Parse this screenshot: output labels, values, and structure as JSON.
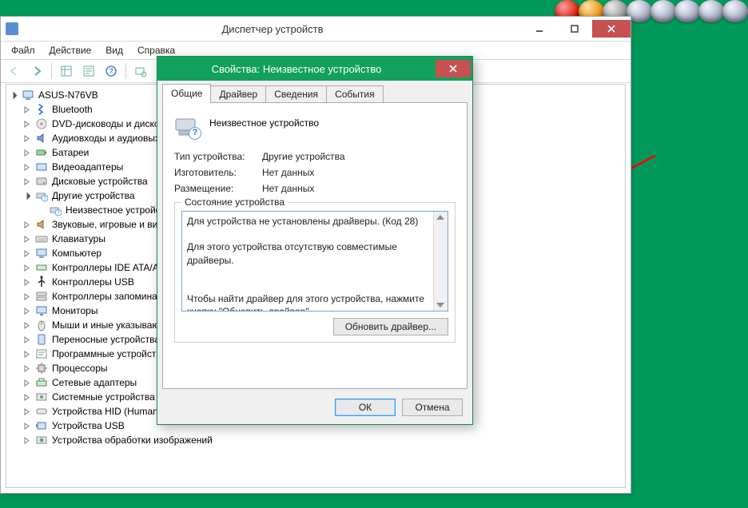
{
  "desktop": {
    "accent": "#00995B"
  },
  "tray_icons": [
    "red",
    "ora",
    "gry",
    "svr",
    "svr",
    "svr",
    "svr",
    "svr"
  ],
  "devmgr": {
    "title": "Диспетчер устройств",
    "menu": {
      "file": "Файл",
      "action": "Действие",
      "view": "Вид",
      "help": "Справка"
    },
    "toolbar": [
      "back",
      "fwd",
      "sep",
      "show",
      "props",
      "help",
      "sep",
      "scan",
      "uninst",
      "upd",
      "dis"
    ],
    "root": "ASUS-N76VB",
    "nodes": [
      {
        "icon": "bt",
        "label": "Bluetooth"
      },
      {
        "icon": "dvd",
        "label": "DVD-дисководы и дисководы компакт-дисков"
      },
      {
        "icon": "aud",
        "label": "Аудиовходы и аудиовыходы"
      },
      {
        "icon": "bat",
        "label": "Батареи"
      },
      {
        "icon": "vid",
        "label": "Видеоадаптеры"
      },
      {
        "icon": "dsk",
        "label": "Дисковые устройства"
      },
      {
        "icon": "unk",
        "label": "Другие устройства",
        "expanded": true,
        "children": [
          {
            "icon": "unk",
            "label": "Неизвестное устройство"
          }
        ]
      },
      {
        "icon": "snd",
        "label": "Звуковые, игровые и видеоустройства"
      },
      {
        "icon": "kbd",
        "label": "Клавиатуры"
      },
      {
        "icon": "comp",
        "label": "Компьютер"
      },
      {
        "icon": "ide",
        "label": "Контроллеры IDE ATA/ATAPI"
      },
      {
        "icon": "usb",
        "label": "Контроллеры USB"
      },
      {
        "icon": "stor",
        "label": "Контроллеры запоминающих устройств"
      },
      {
        "icon": "mon",
        "label": "Мониторы"
      },
      {
        "icon": "mse",
        "label": "Мыши и иные указывающие устройства"
      },
      {
        "icon": "port",
        "label": "Переносные устройства"
      },
      {
        "icon": "sw",
        "label": "Программные устройства"
      },
      {
        "icon": "cpu",
        "label": "Процессоры"
      },
      {
        "icon": "net",
        "label": "Сетевые адаптеры"
      },
      {
        "icon": "sys",
        "label": "Системные устройства"
      },
      {
        "icon": "hid",
        "label": "Устройства HID (Human Interface Devices)"
      },
      {
        "icon": "usbd",
        "label": "Устройства USB"
      },
      {
        "icon": "img",
        "label": "Устройства обработки изображений"
      }
    ]
  },
  "dlg": {
    "title": "Свойства: Неизвестное устройство",
    "tabs": {
      "general": "Общие",
      "driver": "Драйвер",
      "details": "Сведения",
      "events": "События"
    },
    "device_name": "Неизвестное устройство",
    "rows": {
      "type_l": "Тип устройства:",
      "type_v": "Другие устройства",
      "mfr_l": "Изготовитель:",
      "mfr_v": "Нет данных",
      "loc_l": "Размещение:",
      "loc_v": "Нет данных"
    },
    "group_title": "Состояние устройства",
    "status_lines": [
      "Для устройства не установлены драйверы. (Код 28)",
      "",
      "Для этого устройства отсутствую совместимые драйверы.",
      "",
      "",
      "Чтобы найти драйвер для этого устройства, нажмите кнопку \"Обновить драйвер\"."
    ],
    "update_btn": "Обновить драйвер...",
    "ok": "ОК",
    "cancel": "Отмена"
  }
}
